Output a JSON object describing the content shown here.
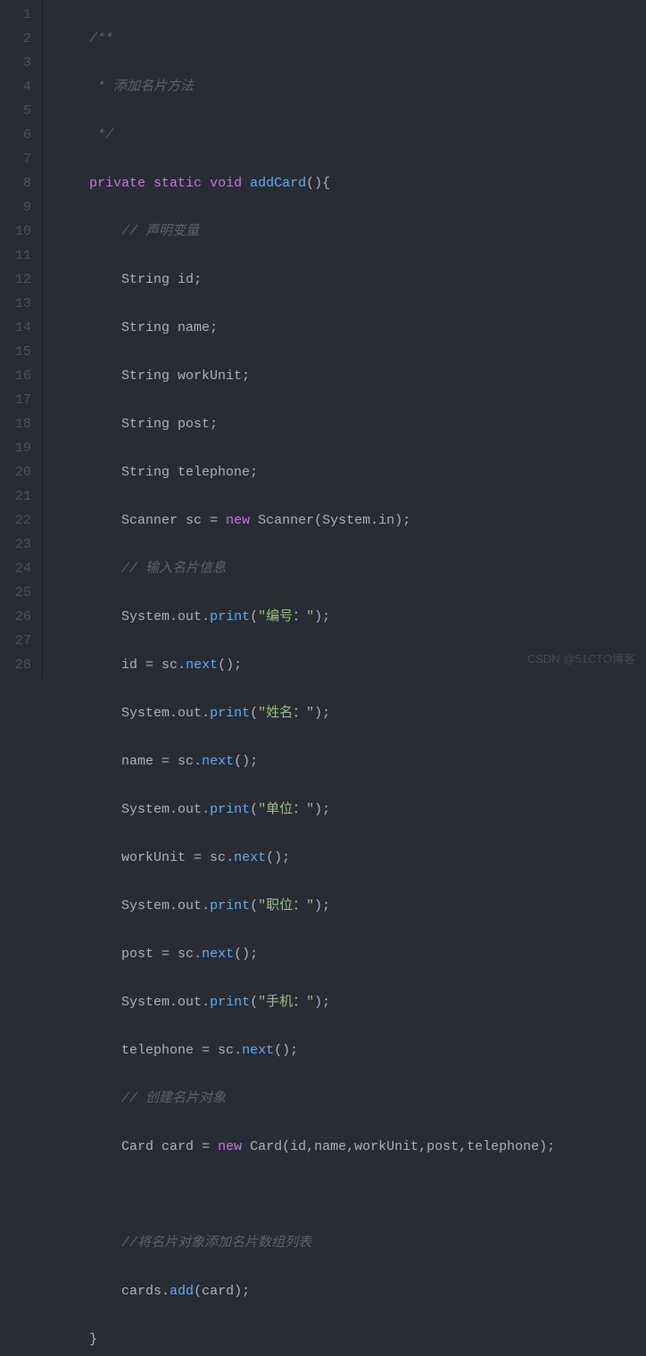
{
  "lines": {
    "l1": "1",
    "l2": "2",
    "l3": "3",
    "l4": "4",
    "l5": "5",
    "l6": "6",
    "l7": "7",
    "l8": "8",
    "l9": "9",
    "l10": "10",
    "l11": "11",
    "l12": "12",
    "l13": "13",
    "l14": "14",
    "l15": "15",
    "l16": "16",
    "l17": "17",
    "l18": "18",
    "l19": "19",
    "l20": "20",
    "l21": "21",
    "l22": "22",
    "l23": "23",
    "l24": "24",
    "l25": "25",
    "l26": "26",
    "l27": "27",
    "l28": "28"
  },
  "code": {
    "c1_comment": "/**",
    "c2_comment": " * 添加名片方法",
    "c3_comment": " */",
    "c4_private": "private",
    "c4_static": "static",
    "c4_void": "void",
    "c4_method": "addCard",
    "c4_parens": "(){",
    "c5_comment": "// 声明变量",
    "c6_type": "String",
    "c6_id": "id",
    "c7_type": "String",
    "c7_id": "name",
    "c8_type": "String",
    "c8_id": "workUnit",
    "c9_type": "String",
    "c9_id": "post",
    "c10_type": "String",
    "c10_id": "telephone",
    "c11_type": "Scanner",
    "c11_id": "sc",
    "c11_eq": " = ",
    "c11_new": "new",
    "c11_class": "Scanner",
    "c11_sys": "System",
    "c11_in": "in",
    "c12_comment": "// 输入名片信息",
    "c13_sys": "System",
    "c13_out": "out",
    "c13_print": "print",
    "c13_str": "\"编号：\"",
    "c14_id": "id",
    "c14_sc": "sc",
    "c14_next": "next",
    "c15_sys": "System",
    "c15_out": "out",
    "c15_print": "print",
    "c15_str": "\"姓名：\"",
    "c16_name": "name",
    "c16_sc": "sc",
    "c16_next": "next",
    "c17_sys": "System",
    "c17_out": "out",
    "c17_print": "print",
    "c17_str": "\"单位：\"",
    "c18_wu": "workUnit",
    "c18_sc": "sc",
    "c18_next": "next",
    "c19_sys": "System",
    "c19_out": "out",
    "c19_print": "print",
    "c19_str": "\"职位：\"",
    "c20_post": "post",
    "c20_sc": "sc",
    "c20_next": "next",
    "c21_sys": "System",
    "c21_out": "out",
    "c21_print": "print",
    "c21_str": "\"手机：\"",
    "c22_tel": "telephone",
    "c22_sc": "sc",
    "c22_next": "next",
    "c23_comment": "// 创建名片对象",
    "c24_type": "Card",
    "c24_var": "card",
    "c24_new": "new",
    "c24_class": "Card",
    "c24_args": "(id,name,workUnit,post,telephone);",
    "c26_comment": "//将名片对象添加名片数组列表",
    "c27_cards": "cards",
    "c27_add": "add",
    "c27_card": "card",
    "c28_brace": "}",
    "semi": ";",
    "dot": ".",
    "lp": "(",
    "rp": ")",
    "eq": " = "
  },
  "watermark": "CSDN @51CTO博客"
}
